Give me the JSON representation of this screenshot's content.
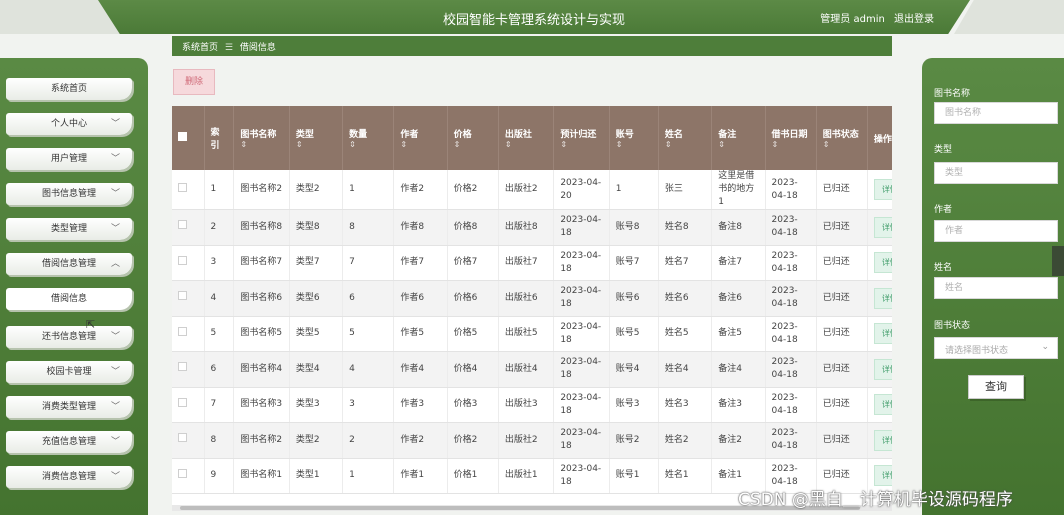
{
  "header": {
    "title": "校园智能卡管理系统设计与实现",
    "user_label": "管理员 admin",
    "logout_label": "退出登录"
  },
  "breadcrumb": {
    "home": "系统首页",
    "separator": "☰",
    "current": "借阅信息"
  },
  "sidebar": {
    "items": [
      {
        "label": "系统首页",
        "chevron": ""
      },
      {
        "label": "个人中心",
        "chevron": "﹀"
      },
      {
        "label": "用户管理",
        "chevron": "﹀"
      },
      {
        "label": "图书信息管理",
        "chevron": "﹀"
      },
      {
        "label": "类型管理",
        "chevron": "﹀"
      },
      {
        "label": "借阅信息管理",
        "chevron": "︿"
      },
      {
        "label": "借阅信息",
        "chevron": ""
      },
      {
        "label": "还书信息管理",
        "chevron": "﹀"
      },
      {
        "label": "校园卡管理",
        "chevron": "﹀"
      },
      {
        "label": "消费类型管理",
        "chevron": "﹀"
      },
      {
        "label": "充值信息管理",
        "chevron": "﹀"
      },
      {
        "label": "消费信息管理",
        "chevron": "﹀"
      }
    ]
  },
  "toolbar": {
    "delete_label": "删除"
  },
  "search": {
    "book_name_label": "图书名称",
    "book_name_placeholder": "图书名称",
    "type_label": "类型",
    "type_placeholder": "类型",
    "author_label": "作者",
    "author_placeholder": "作者",
    "name_label": "姓名",
    "name_placeholder": "姓名",
    "status_label": "图书状态",
    "status_placeholder": "请选择图书状态",
    "query_label": "查询"
  },
  "table": {
    "headers": {
      "index": "索引",
      "book_name": "图书名称",
      "type": "类型",
      "quantity": "数量",
      "author": "作者",
      "price": "价格",
      "publisher": "出版社",
      "due_date": "预计归还",
      "account": "账号",
      "name": "姓名",
      "remark": "备注",
      "borrow_date": "借书日期",
      "status": "图书状态",
      "action": "操作",
      "sort_icon": "⇕"
    },
    "detail_label": "详情",
    "rows": [
      {
        "index": "1",
        "book_name": "图书名称2",
        "type": "类型2",
        "quantity": "1",
        "author": "作者2",
        "price": "价格2",
        "publisher": "出版社2",
        "due_date": "2023-04-20",
        "account": "1",
        "name": "张三",
        "remark": "这里是借书的地方1",
        "borrow_date": "2023-04-18",
        "status": "已归还"
      },
      {
        "index": "2",
        "book_name": "图书名称8",
        "type": "类型8",
        "quantity": "8",
        "author": "作者8",
        "price": "价格8",
        "publisher": "出版社8",
        "due_date": "2023-04-18",
        "account": "账号8",
        "name": "姓名8",
        "remark": "备注8",
        "borrow_date": "2023-04-18",
        "status": "已归还"
      },
      {
        "index": "3",
        "book_name": "图书名称7",
        "type": "类型7",
        "quantity": "7",
        "author": "作者7",
        "price": "价格7",
        "publisher": "出版社7",
        "due_date": "2023-04-18",
        "account": "账号7",
        "name": "姓名7",
        "remark": "备注7",
        "borrow_date": "2023-04-18",
        "status": "已归还"
      },
      {
        "index": "4",
        "book_name": "图书名称6",
        "type": "类型6",
        "quantity": "6",
        "author": "作者6",
        "price": "价格6",
        "publisher": "出版社6",
        "due_date": "2023-04-18",
        "account": "账号6",
        "name": "姓名6",
        "remark": "备注6",
        "borrow_date": "2023-04-18",
        "status": "已归还"
      },
      {
        "index": "5",
        "book_name": "图书名称5",
        "type": "类型5",
        "quantity": "5",
        "author": "作者5",
        "price": "价格5",
        "publisher": "出版社5",
        "due_date": "2023-04-18",
        "account": "账号5",
        "name": "姓名5",
        "remark": "备注5",
        "borrow_date": "2023-04-18",
        "status": "已归还"
      },
      {
        "index": "6",
        "book_name": "图书名称4",
        "type": "类型4",
        "quantity": "4",
        "author": "作者4",
        "price": "价格4",
        "publisher": "出版社4",
        "due_date": "2023-04-18",
        "account": "账号4",
        "name": "姓名4",
        "remark": "备注4",
        "borrow_date": "2023-04-18",
        "status": "已归还"
      },
      {
        "index": "7",
        "book_name": "图书名称3",
        "type": "类型3",
        "quantity": "3",
        "author": "作者3",
        "price": "价格3",
        "publisher": "出版社3",
        "due_date": "2023-04-18",
        "account": "账号3",
        "name": "姓名3",
        "remark": "备注3",
        "borrow_date": "2023-04-18",
        "status": "已归还"
      },
      {
        "index": "8",
        "book_name": "图书名称2",
        "type": "类型2",
        "quantity": "2",
        "author": "作者2",
        "price": "价格2",
        "publisher": "出版社2",
        "due_date": "2023-04-18",
        "account": "账号2",
        "name": "姓名2",
        "remark": "备注2",
        "borrow_date": "2023-04-18",
        "status": "已归还"
      },
      {
        "index": "9",
        "book_name": "图书名称1",
        "type": "类型1",
        "quantity": "1",
        "author": "作者1",
        "price": "价格1",
        "publisher": "出版社1",
        "due_date": "2023-04-18",
        "account": "账号1",
        "name": "姓名1",
        "remark": "备注1",
        "borrow_date": "2023-04-18",
        "status": "已归还"
      }
    ]
  },
  "watermark": "CSDN @黑白＿计算机毕设源码程序",
  "colors": {
    "primary_green": "#4e7e3a",
    "table_header": "#8d7568",
    "delete_pink": "#f6d9dc",
    "detail_green": "#3d9b68"
  }
}
